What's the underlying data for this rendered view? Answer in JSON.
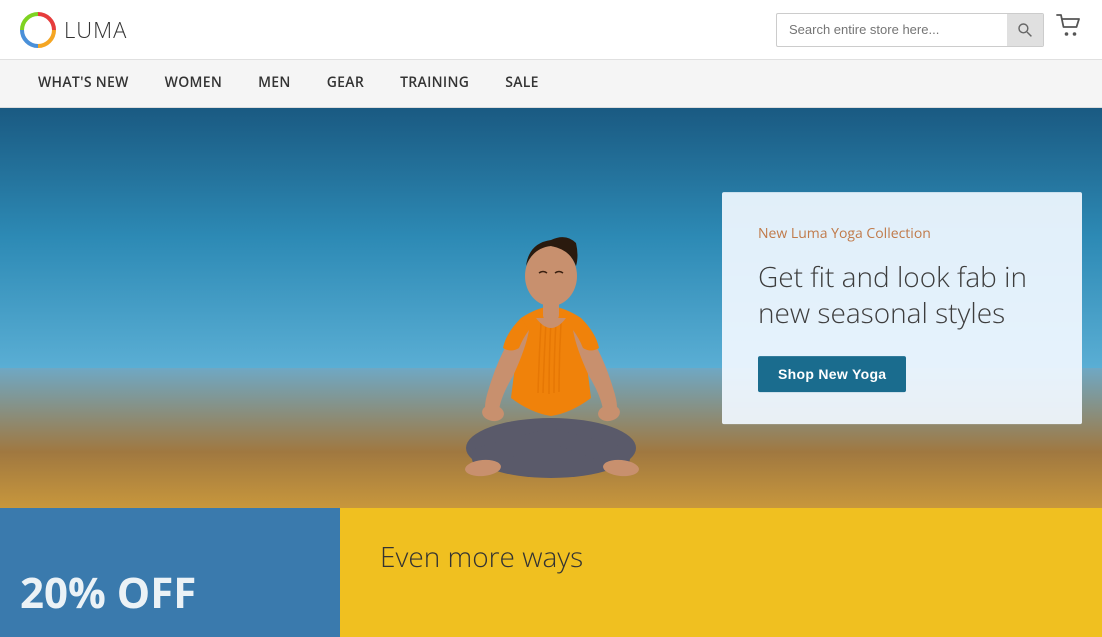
{
  "header": {
    "logo_text": "LUMA",
    "search_placeholder": "Search entire store here...",
    "cart_icon": "cart-icon"
  },
  "nav": {
    "items": [
      {
        "label": "What's New",
        "id": "whats-new"
      },
      {
        "label": "Women",
        "id": "women"
      },
      {
        "label": "Men",
        "id": "men"
      },
      {
        "label": "Gear",
        "id": "gear"
      },
      {
        "label": "Training",
        "id": "training"
      },
      {
        "label": "Sale",
        "id": "sale"
      }
    ]
  },
  "hero": {
    "subtitle": "New Luma Yoga Collection",
    "title": "Get fit and look fab in new seasonal styles",
    "cta_button": "Shop New Yoga"
  },
  "bottom": {
    "banner_left_text": "20% OFF",
    "banner_right_text": "Even more ways"
  }
}
